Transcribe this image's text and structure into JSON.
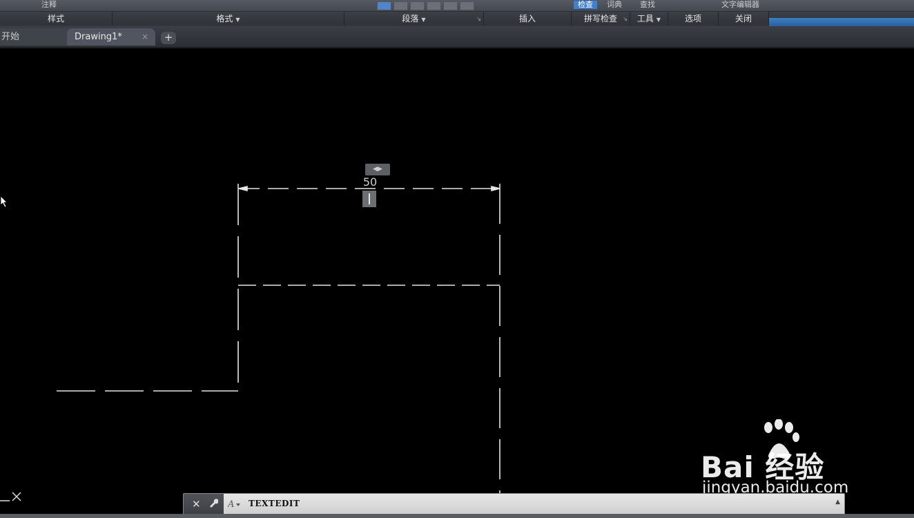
{
  "ribbon": {
    "groups": [
      {
        "label": "样式",
        "has_dropdown": false
      },
      {
        "label": "格式",
        "has_dropdown": true
      },
      {
        "label": "段落",
        "has_dropdown": true
      },
      {
        "label": "插入",
        "has_dropdown": false
      },
      {
        "label": "拼写检查",
        "has_dropdown": false
      },
      {
        "label": "工具",
        "has_dropdown": true
      },
      {
        "label": "选项",
        "has_dropdown": false
      },
      {
        "label": "关闭",
        "has_dropdown": false
      }
    ],
    "top_buttons": {
      "style_label": "注释",
      "spell_check": "检查",
      "dictionary": "词典",
      "find": "查找",
      "close_editor": "文字编辑器"
    },
    "dropdown_glyph": "▼",
    "corner_glyph": "↘"
  },
  "tabs": {
    "start_label": "开始",
    "drawing_label": "Drawing1*",
    "close_glyph": "×",
    "add_glyph": "+"
  },
  "canvas": {
    "dimension_value": "50",
    "grip_glyph": "◀▶"
  },
  "command_line": {
    "text": "TEXTEDIT",
    "close_glyph": "✕",
    "wrench_icon": "wrench-icon",
    "scroll_glyph": "▲"
  },
  "watermark": {
    "brand": "Bai  经验",
    "url": "jingyan.baidu.com"
  },
  "colors": {
    "canvas": "#000000",
    "ribbon_accent": "#3f7ed0",
    "line": "#e6e6e6"
  }
}
